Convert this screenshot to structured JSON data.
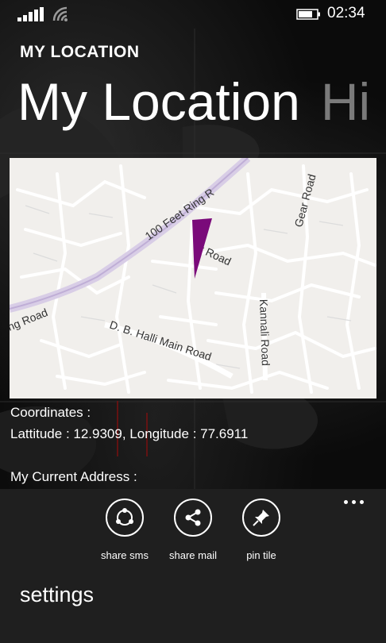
{
  "status_bar": {
    "time": "02:34",
    "icons": [
      "signal-icon",
      "wifi-icon",
      "battery-icon"
    ]
  },
  "app": {
    "title": "MY LOCATION"
  },
  "pivot": {
    "active_label": "My Location",
    "next_label": "Hi"
  },
  "map": {
    "road_labels": {
      "ring_road_upper": "100 Feet Ring R",
      "ring_road_lower": "ng Road",
      "gear_road": "Gear Road",
      "kannali_road": "Kannali Road",
      "cut_road": "r Road",
      "db_halli": "D. B. Halli Main Road"
    },
    "marker_color": "#7a0a7a"
  },
  "location": {
    "coordinates_label": "Coordinates :",
    "coordinates_value": "Lattitude : 12.9309, Longitude : 77.6911",
    "address_label": "My Current Address :"
  },
  "app_bar": {
    "more_icon": "more-icon",
    "buttons": [
      {
        "label": "share sms",
        "icon": "share-sms-icon"
      },
      {
        "label": "share mail",
        "icon": "share-mail-icon"
      },
      {
        "label": "pin tile",
        "icon": "pin-icon"
      }
    ],
    "menu_item": "settings"
  }
}
